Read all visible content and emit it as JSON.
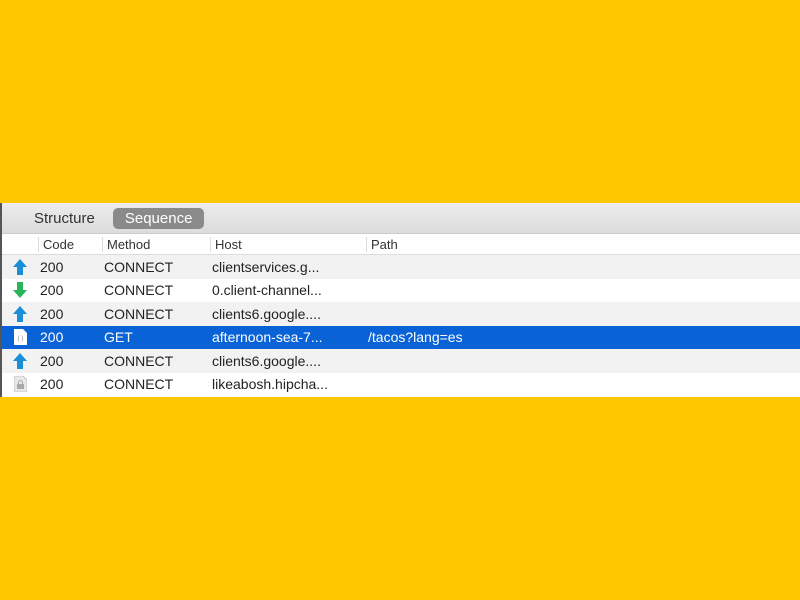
{
  "tabs": [
    {
      "label": "Structure",
      "active": false
    },
    {
      "label": "Sequence",
      "active": true
    }
  ],
  "columns": {
    "code": "Code",
    "method": "Method",
    "host": "Host",
    "path": "Path"
  },
  "rows": [
    {
      "icon": "upload-arrow-icon",
      "code": "200",
      "method": "CONNECT",
      "host": "clientservices.g...",
      "path": "",
      "selected": false
    },
    {
      "icon": "download-arrow-icon",
      "code": "200",
      "method": "CONNECT",
      "host": "0.client-channel...",
      "path": "",
      "selected": false
    },
    {
      "icon": "upload-arrow-icon",
      "code": "200",
      "method": "CONNECT",
      "host": "clients6.google....",
      "path": "",
      "selected": false
    },
    {
      "icon": "json-file-icon",
      "code": "200",
      "method": "GET",
      "host": "afternoon-sea-7...",
      "path": "/tacos?lang=es",
      "selected": true
    },
    {
      "icon": "upload-arrow-icon",
      "code": "200",
      "method": "CONNECT",
      "host": "clients6.google....",
      "path": "",
      "selected": false
    },
    {
      "icon": "lock-file-icon",
      "code": "200",
      "method": "CONNECT",
      "host": "likeabosh.hipcha...",
      "path": "",
      "selected": false
    }
  ],
  "colors": {
    "background": "#fec800",
    "selected": "#0a63d6",
    "up": "#1a8fd8",
    "down": "#2bb55a"
  }
}
